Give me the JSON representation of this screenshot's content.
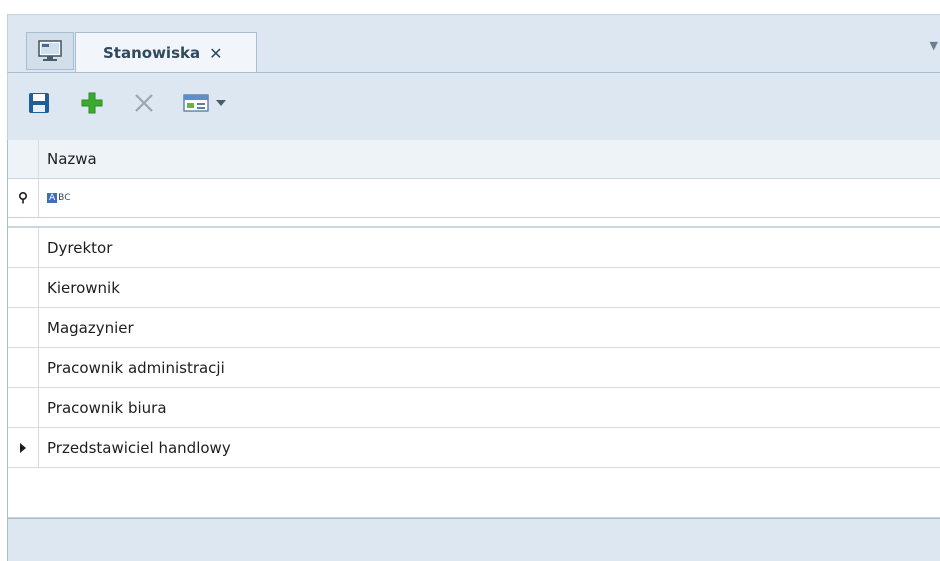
{
  "tab": {
    "icon": "monitor-icon",
    "title": "Stanowiska",
    "close_glyph": "✕",
    "menu_glyph": "▼"
  },
  "toolbar": {
    "buttons": [
      {
        "name": "save",
        "icon": "floppy-disk-icon"
      },
      {
        "name": "add",
        "icon": "plus-icon"
      },
      {
        "name": "delete",
        "icon": "x-icon"
      },
      {
        "name": "export",
        "icon": "spreadsheet-export-icon"
      },
      {
        "name": "export-dropdown",
        "icon": "chevron-down-icon"
      }
    ]
  },
  "grid": {
    "column_header": "Nazwa",
    "filter_icon": "pin-icon",
    "filter_type_badge": "ABC",
    "rows": [
      {
        "label": "Dyrektor",
        "current": false
      },
      {
        "label": "Kierownik",
        "current": false
      },
      {
        "label": "Magazynier",
        "current": false
      },
      {
        "label": "Pracownik administracji",
        "current": false
      },
      {
        "label": "Pracownik biura",
        "current": false
      },
      {
        "label": "Przedstawiciel handlowy",
        "current": true
      }
    ]
  },
  "colors": {
    "accent_green": "#3caa2f",
    "save_blue": "#1f5d9c",
    "chrome_bg": "#dde7f1"
  }
}
